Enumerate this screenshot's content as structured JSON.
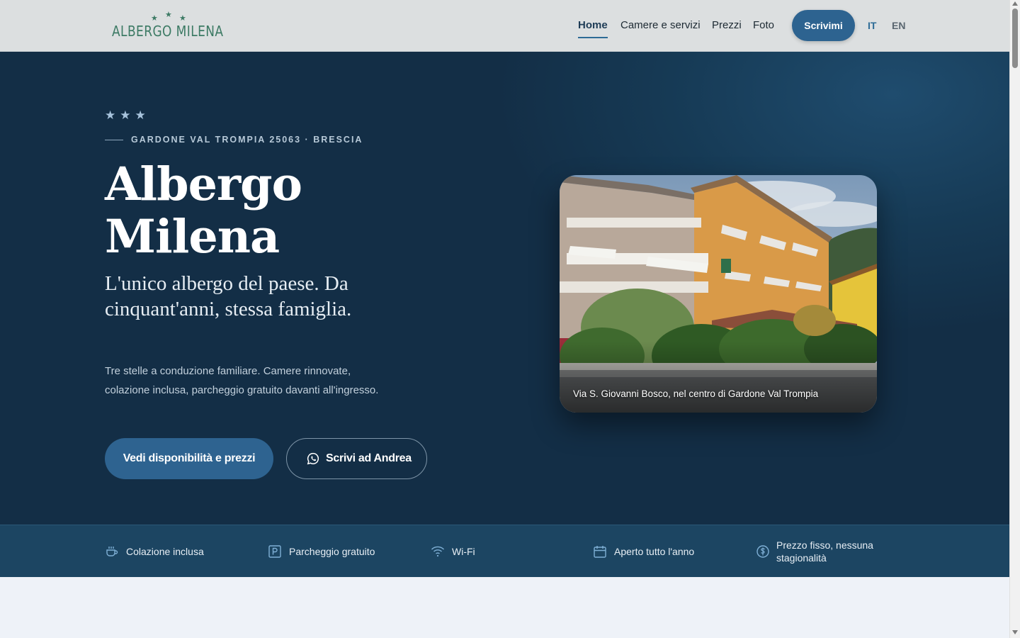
{
  "header": {
    "logo_text": "ALBERGO MILENA",
    "nav": [
      {
        "label": "Home",
        "active": true
      },
      {
        "label": "Camere e servizi",
        "active": false
      },
      {
        "label": "Prezzi",
        "active": false
      },
      {
        "label": "Foto",
        "active": false
      }
    ],
    "cta_label": "Scrivimi",
    "languages": [
      {
        "code": "IT",
        "active": true
      },
      {
        "code": "EN",
        "active": false
      }
    ]
  },
  "hero": {
    "stars": "★ ★ ★",
    "eyebrow": "GARDONE VAL TROMPIA 25063 · BRESCIA",
    "title_line1": "Albergo",
    "title_line2": "Milena",
    "subtitle": "L'unico albergo del paese. Da cinquant'anni, stessa famiglia.",
    "description": "Tre stelle a conduzione familiare. Camere rinnovate, colazione inclusa, parcheggio gratuito davanti all'ingresso.",
    "primary_button": "Vedi disponibilità e prezzi",
    "secondary_button": "Scrivi ad Andrea",
    "photo_caption": "Via S. Giovanni Bosco, nel centro di Gardone Val Trompia"
  },
  "features": [
    {
      "icon": "coffee-cup-icon",
      "label": "Colazione inclusa"
    },
    {
      "icon": "parking-icon",
      "label": "Parcheggio gratuito"
    },
    {
      "icon": "wifi-icon",
      "label": "Wi-Fi"
    },
    {
      "icon": "calendar-icon",
      "label": "Aperto tutto l'anno"
    },
    {
      "icon": "euro-coin-icon",
      "label": "Prezzo fisso, nessuna stagionalità"
    }
  ],
  "colors": {
    "hero_bg": "#132e46",
    "accent": "#2d6390",
    "logo_green": "#3c7a64",
    "features_bg": "#1c4562"
  }
}
